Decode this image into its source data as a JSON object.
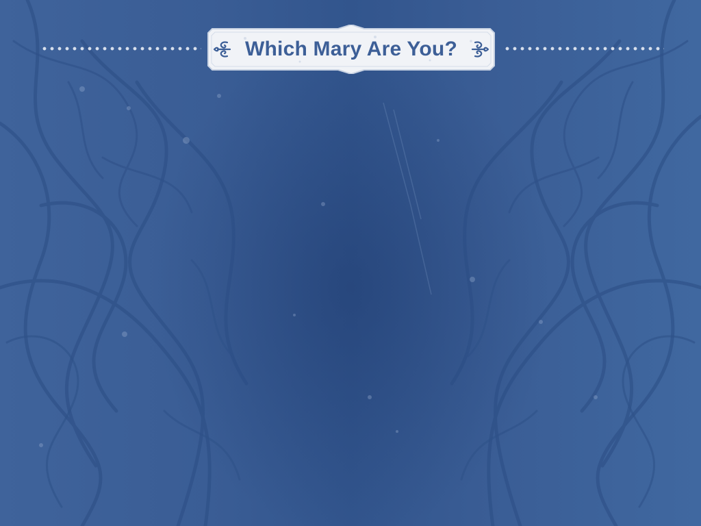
{
  "slide": {
    "title": "Which Mary Are You?"
  },
  "icons": {
    "left_ornament": "scroll-flourish-icon",
    "right_ornament": "scroll-flourish-icon"
  },
  "colors": {
    "background": "#3a5c93",
    "banner_fill": "#f1f3f7",
    "title_text": "#3d5f97",
    "dots": "#e8edf5"
  }
}
